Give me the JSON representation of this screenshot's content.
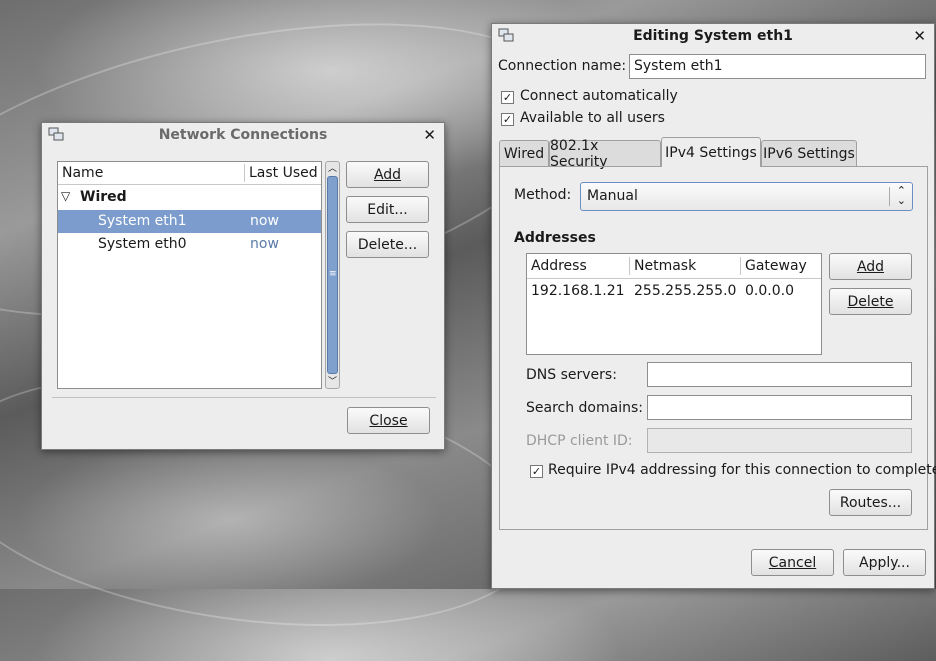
{
  "network_connections": {
    "title": "Network Connections",
    "columns": [
      "Name",
      "Last Used"
    ],
    "group": "Wired",
    "rows": [
      {
        "name": "System eth1",
        "last_used": "now"
      },
      {
        "name": "System eth0",
        "last_used": "now"
      }
    ],
    "buttons": {
      "add": "Add",
      "edit": "Edit...",
      "delete": "Delete...",
      "close": "Close"
    }
  },
  "editing": {
    "title": "Editing System eth1",
    "connection_name_label": "Connection name:",
    "connection_name_value": "System eth1",
    "connect_automatically": "Connect automatically",
    "available_to_all": "Available to all users",
    "tabs": [
      "Wired",
      "802.1x Security",
      "IPv4 Settings",
      "IPv6 Settings"
    ],
    "method_label": "Method:",
    "method_value": "Manual",
    "addresses_heading": "Addresses",
    "address_columns": [
      "Address",
      "Netmask",
      "Gateway"
    ],
    "address_rows": [
      {
        "address": "192.168.1.21",
        "netmask": "255.255.255.0",
        "gateway": "0.0.0.0"
      }
    ],
    "add_button": "Add",
    "delete_button": "Delete",
    "dns_label": "DNS servers:",
    "search_label": "Search domains:",
    "dhcp_label": "DHCP client ID:",
    "require_ipv4": "Require IPv4 addressing for this connection to complete",
    "routes_button": "Routes...",
    "cancel_button": "Cancel",
    "apply_button": "Apply..."
  }
}
